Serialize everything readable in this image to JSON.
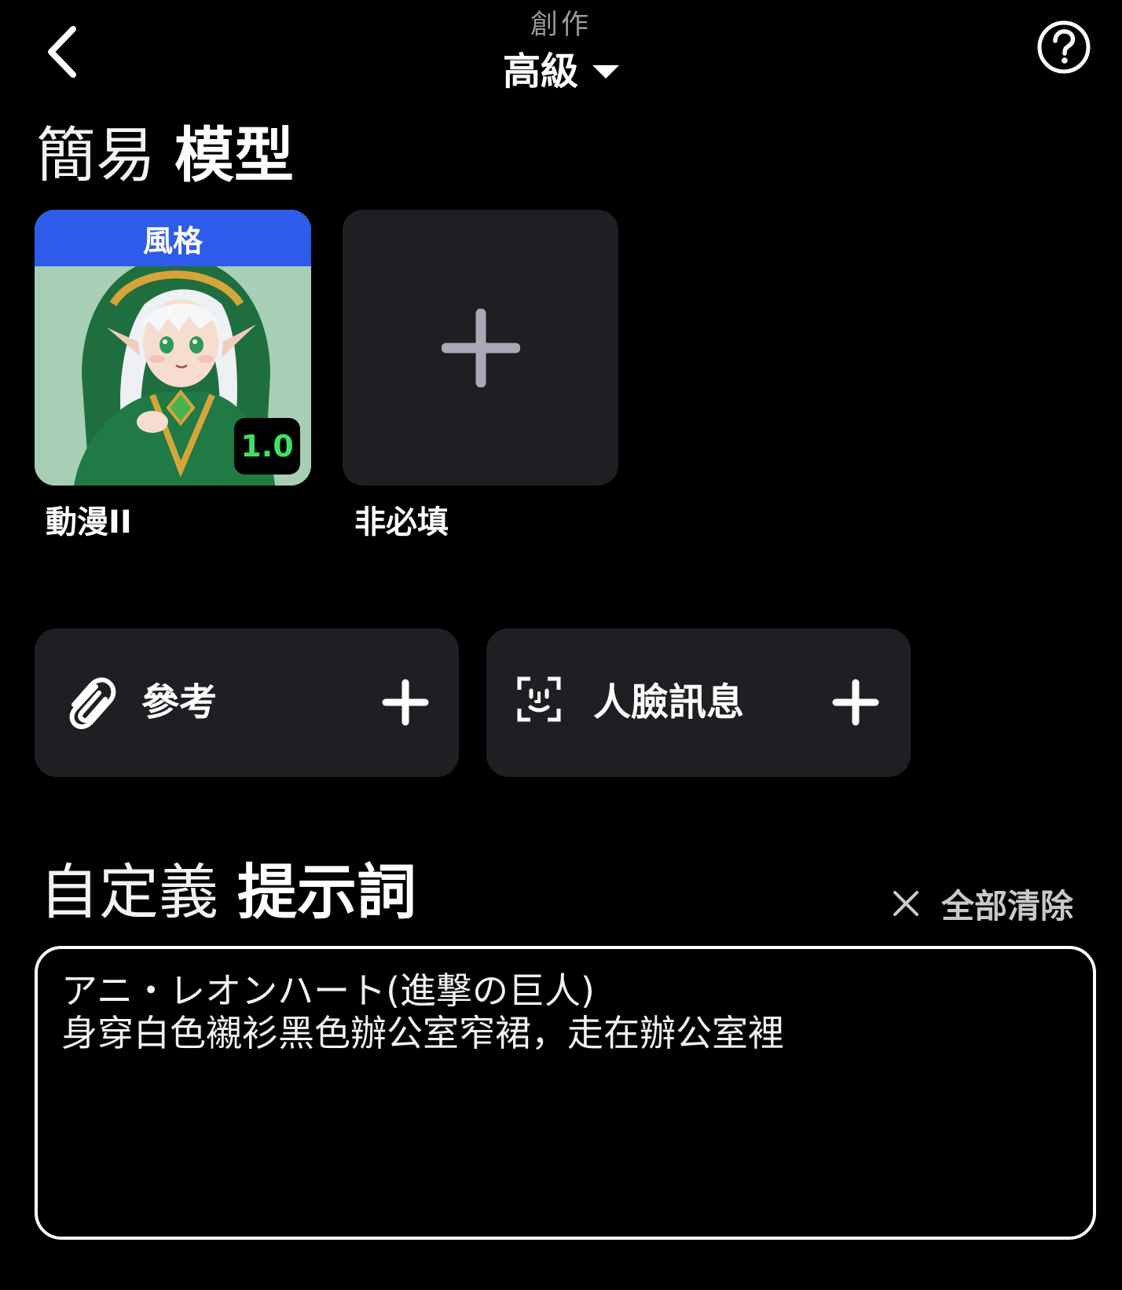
{
  "header": {
    "subtitle": "創作",
    "mode_label": "高級"
  },
  "model_section": {
    "title_light": "簡易",
    "title_bold": "模型",
    "selected_model": {
      "tag": "風格",
      "version": "1.0",
      "name": "動漫II"
    },
    "add_model": {
      "label": "非必填"
    }
  },
  "reference": {
    "label": "參考"
  },
  "face_info": {
    "label": "人臉訊息"
  },
  "prompt_section": {
    "title_light": "自定義",
    "title_bold": "提示詞",
    "clear_all_label": "全部清除",
    "prompt_lines": [
      "アニ・レオンハート(進撃の巨人)",
      "身穿白色襯衫黑色辦公室窄裙，走在辦公室裡"
    ]
  },
  "colors": {
    "background": "#000000",
    "card": "#1e1f22",
    "style_tag": "#2f5bea",
    "version_text": "#3ee06a"
  },
  "icons": {
    "back": "chevron-left-icon",
    "help": "help-circle-icon",
    "dropdown": "caret-down-icon",
    "add": "plus-icon",
    "reference": "paperclip-icon",
    "face": "face-scan-icon",
    "clear": "close-icon"
  }
}
